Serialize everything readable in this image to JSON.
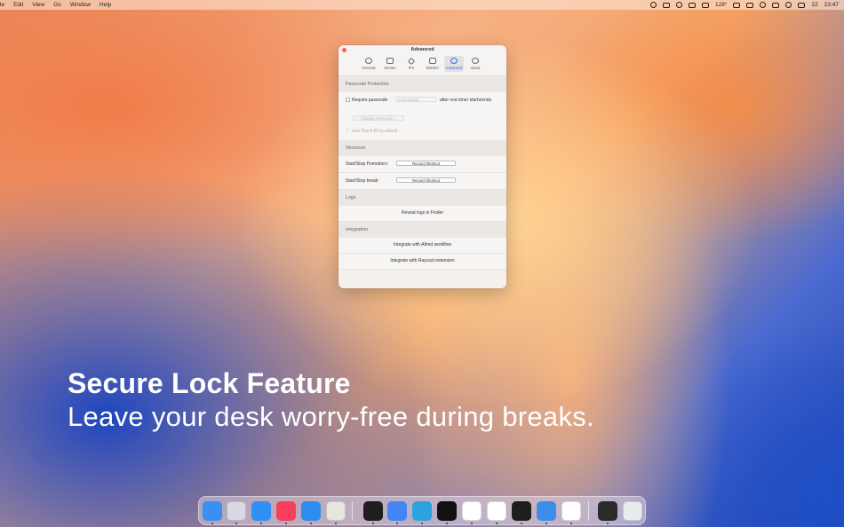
{
  "menubar": {
    "items": [
      "le",
      "Edit",
      "View",
      "Go",
      "Window",
      "Help"
    ],
    "temperature": "128°",
    "clock": "23:47",
    "date_badge": "22"
  },
  "window": {
    "title": "Advanced",
    "tabs": [
      {
        "label": "General",
        "icon": "gear-icon"
      },
      {
        "label": "Screen",
        "icon": "picture-icon"
      },
      {
        "label": "Pro",
        "icon": "diamond-icon"
      },
      {
        "label": "Blocker",
        "icon": "block-icon"
      },
      {
        "label": "Advanced",
        "icon": "link-icon"
      },
      {
        "label": "About",
        "icon": "info-icon"
      }
    ],
    "active_tab": "Advanced",
    "passcode": {
      "section": "Passcode Protection",
      "require_label": "Require passcode",
      "select_value": "Immediately",
      "after_label": "after rest timer starts/ends",
      "change_button": "Change Passcode...",
      "touch_id_label": "Use Touch ID to unlock"
    },
    "shortcuts": {
      "section": "Shortcuts",
      "start_stop_pomodoro": "Start/Stop Pomodoro:",
      "start_stop_break": "Start/Stop break:",
      "record_label": "Record Shortcut"
    },
    "logs": {
      "section": "Logs",
      "reveal_label": "Reveal logs in Finder"
    },
    "integration": {
      "section": "Integration",
      "alfred_label": "Integrate with Alfred workflow",
      "raycast_label": "Integrate with Raycast extension"
    }
  },
  "marketing": {
    "headline": "Secure Lock Feature",
    "subline": "Leave your desk worry-free during breaks."
  },
  "dock": {
    "apps": [
      {
        "name": "finder-icon",
        "color": "#3b8ff0"
      },
      {
        "name": "launchpad-icon",
        "color": "#d9d9e3"
      },
      {
        "name": "mail-icon",
        "color": "#2f8ff5"
      },
      {
        "name": "music-icon",
        "color": "#f93d5c"
      },
      {
        "name": "app-store-icon",
        "color": "#2d8cf0"
      },
      {
        "name": "pencil-app-icon",
        "color": "#e8e4e0"
      },
      {
        "name": "terminal-icon",
        "color": "#1e1e1e"
      },
      {
        "name": "chrome-icon",
        "color": "#4285f4"
      },
      {
        "name": "telegram-icon",
        "color": "#2aa3e0"
      },
      {
        "name": "cube-app-icon",
        "color": "#111111"
      },
      {
        "name": "notion-icon",
        "color": "#ffffff"
      },
      {
        "name": "chatgpt-icon",
        "color": "#ffffff"
      },
      {
        "name": "figma-icon",
        "color": "#1e1e1e"
      },
      {
        "name": "xcode-icon",
        "color": "#3a8de8"
      },
      {
        "name": "vscode-icon",
        "color": "#ffffff"
      },
      {
        "name": "screen-recorder-icon",
        "color": "#2b2b2b"
      },
      {
        "name": "trash-icon",
        "color": "#e9ecef"
      }
    ]
  },
  "colors": {
    "accent": "#2b6ef5",
    "close": "#ff5f57"
  }
}
